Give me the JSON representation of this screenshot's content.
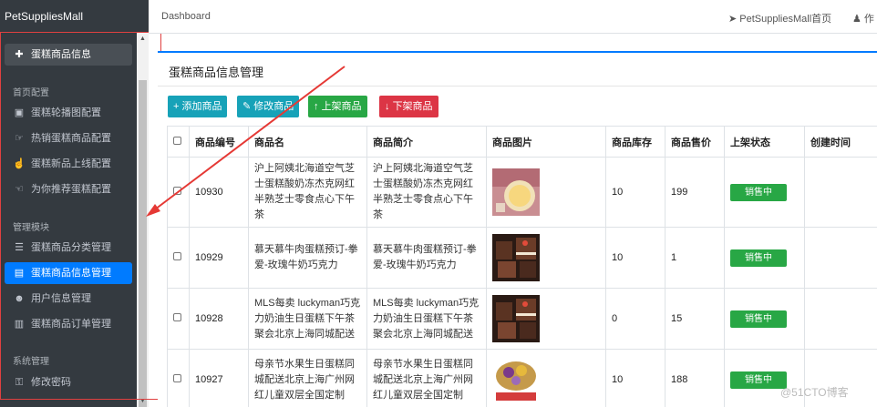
{
  "brand": "PetSuppliesMall",
  "sidebar": {
    "top_item": "蛋糕商品信息",
    "sections": [
      {
        "header": "首页配置",
        "items": [
          {
            "label": "蛋糕轮播图配置",
            "icon": "image-icon"
          },
          {
            "label": "热销蛋糕商品配置",
            "icon": "fire-icon"
          },
          {
            "label": "蛋糕新品上线配置",
            "icon": "hand-icon"
          },
          {
            "label": "为你推荐蛋糕配置",
            "icon": "thumb-icon"
          }
        ]
      },
      {
        "header": "管理模块",
        "items": [
          {
            "label": "蛋糕商品分类管理",
            "icon": "list-icon"
          },
          {
            "label": "蛋糕商品信息管理",
            "icon": "inbox-icon"
          },
          {
            "label": "用户信息管理",
            "icon": "users-icon"
          },
          {
            "label": "蛋糕商品订单管理",
            "icon": "money-icon"
          }
        ]
      },
      {
        "header": "系统管理",
        "items": [
          {
            "label": "修改密码",
            "icon": "lock-icon"
          }
        ]
      }
    ]
  },
  "topbar": {
    "crumb": "Dashboard",
    "home": "PetSuppliesMall首页",
    "user": "作"
  },
  "card": {
    "title": "蛋糕商品信息管理",
    "buttons": {
      "add": "添加商品",
      "edit": "修改商品",
      "up": "上架商品",
      "down": "下架商品"
    }
  },
  "table": {
    "headers": [
      "商品编号",
      "商品名",
      "商品简介",
      "商品图片",
      "商品库存",
      "商品售价",
      "上架状态",
      "创建时间"
    ],
    "rows": [
      {
        "id": "10930",
        "name": "沪上阿姨北海道空气芝士蛋糕酸奶冻杰克网红半熟芝士零食点心下午茶",
        "intro": "沪上阿姨北海道空气芝士蛋糕酸奶冻杰克网红半熟芝士零食点心下午茶",
        "stock": "10",
        "price": "199",
        "status": "销售中",
        "image": "cheese"
      },
      {
        "id": "10929",
        "name": "慕天慕牛肉蛋糕预订-拳爱-玫瑰牛奶巧克力",
        "intro": "慕天慕牛肉蛋糕预订-拳爱-玫瑰牛奶巧克力",
        "stock": "10",
        "price": "1",
        "status": "销售中",
        "image": "choco"
      },
      {
        "id": "10928",
        "name": "MLS每卖 luckyman巧克力奶油生日蛋糕下午茶聚会北京上海同城配送",
        "intro": "MLS每卖 luckyman巧克力奶油生日蛋糕下午茶聚会北京上海同城配送",
        "stock": "0",
        "price": "15",
        "status": "销售中",
        "image": "choco"
      },
      {
        "id": "10927",
        "name": "母亲节水果生日蛋糕同城配送北京上海广州网红儿童双层全国定制",
        "intro": "母亲节水果生日蛋糕同城配送北京上海广州网红儿童双层全国定制",
        "stock": "10",
        "price": "188",
        "status": "销售中",
        "image": "fruit"
      }
    ]
  },
  "watermark": "@51CTO博客",
  "colors": {
    "sidebar_bg": "#343a40",
    "active": "#007bff",
    "info": "#17a2b8",
    "success": "#28a745",
    "danger": "#dc3545"
  }
}
